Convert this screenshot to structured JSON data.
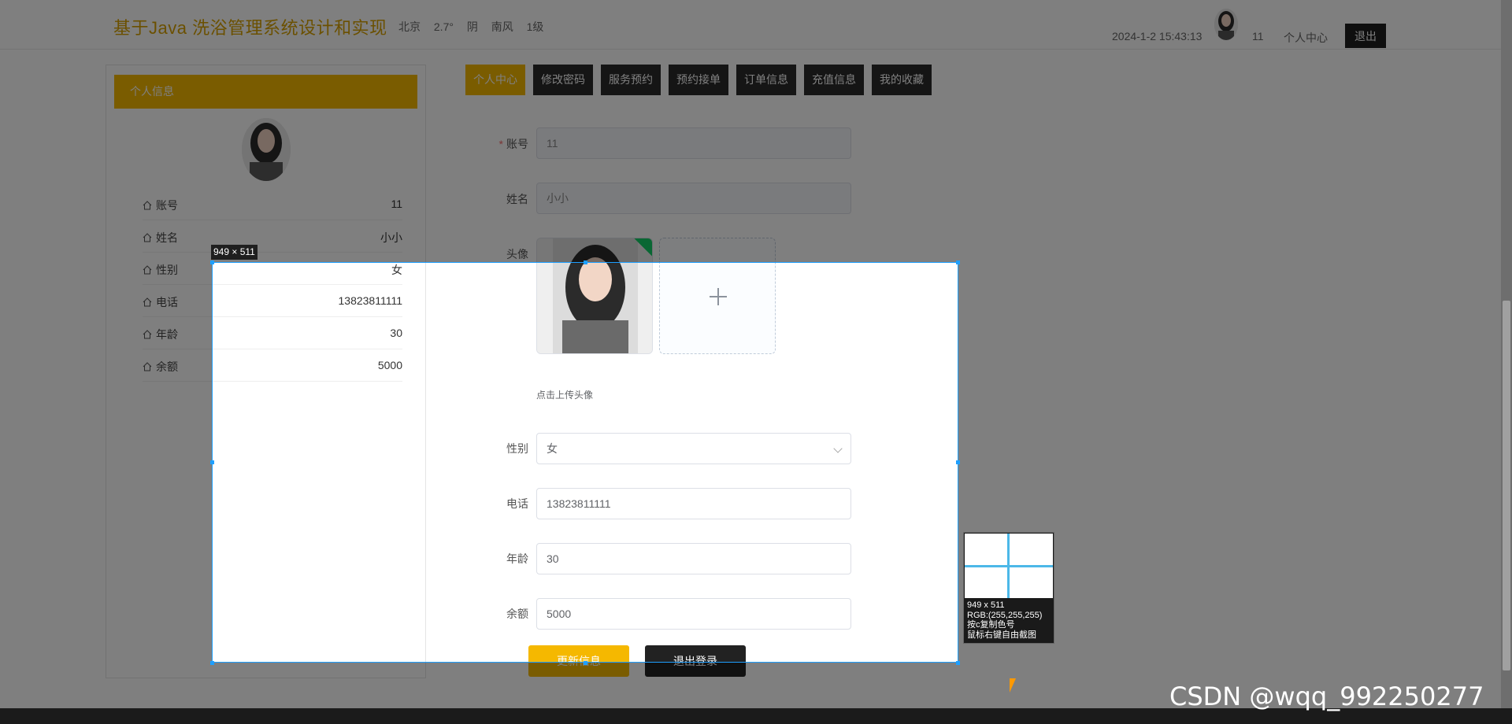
{
  "header": {
    "site_title": "基于Java 洗浴管理系统设计和实现",
    "weather": {
      "city": "北京",
      "temp": "2.7°",
      "condition": "阴",
      "wind": "南风",
      "level": "1级"
    },
    "datetime": "2024-1-2 15:43:13",
    "username": "11",
    "profile_link": "个人中心",
    "logout_label": "退出"
  },
  "sidebar": {
    "title": "个人信息",
    "rows": [
      {
        "label": "账号",
        "value": "11"
      },
      {
        "label": "姓名",
        "value": "小小"
      },
      {
        "label": "性别",
        "value": "女"
      },
      {
        "label": "电话",
        "value": "13823811111"
      },
      {
        "label": "年龄",
        "value": "30"
      },
      {
        "label": "余额",
        "value": "5000"
      }
    ]
  },
  "tabs": [
    {
      "label": "个人中心",
      "active": true
    },
    {
      "label": "修改密码"
    },
    {
      "label": "服务预约"
    },
    {
      "label": "预约接单"
    },
    {
      "label": "订单信息"
    },
    {
      "label": "充值信息"
    },
    {
      "label": "我的收藏"
    }
  ],
  "form": {
    "account": {
      "label": "账号",
      "value": "11"
    },
    "name": {
      "label": "姓名",
      "value": "小小"
    },
    "avatar": {
      "label": "头像",
      "hint": "点击上传头像"
    },
    "gender": {
      "label": "性别",
      "value": "女"
    },
    "phone": {
      "label": "电话",
      "value": "13823811111"
    },
    "age": {
      "label": "年龄",
      "value": "30"
    },
    "balance": {
      "label": "余额",
      "value": "5000"
    },
    "update_button": "更新信息",
    "logout_button": "退出登录"
  },
  "capture_tool": {
    "size_tag": "949 × 511",
    "mag_size": "949 x 511",
    "mag_rgb": "RGB:(255,255,255)",
    "mag_copy_hint": "按c复制色号",
    "mag_right_click_hint": "鼠标右键自由截图"
  },
  "watermark": "CSDN @wqq_992250277",
  "colors": {
    "accent": "#f5b800",
    "dark": "#2a2a2a",
    "selection": "#1e9fff"
  }
}
